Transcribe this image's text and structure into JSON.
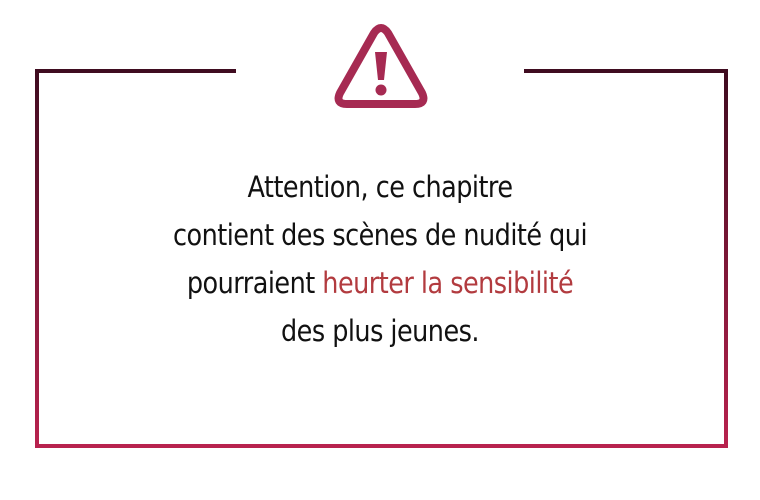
{
  "colors": {
    "frame_top": "#3f0c20",
    "frame_bottom": "#b8224e",
    "icon": "#a62a52",
    "highlight_text": "#b23b3f",
    "body_text": "#111111"
  },
  "icon": "warning-triangle-exclamation",
  "message": {
    "line1": "Attention, ce chapitre",
    "line2": "contient des scènes de nudité qui",
    "line3_start": "pourraient ",
    "line3_highlight": "heurter la sensibilité",
    "line4": "des plus jeunes."
  }
}
